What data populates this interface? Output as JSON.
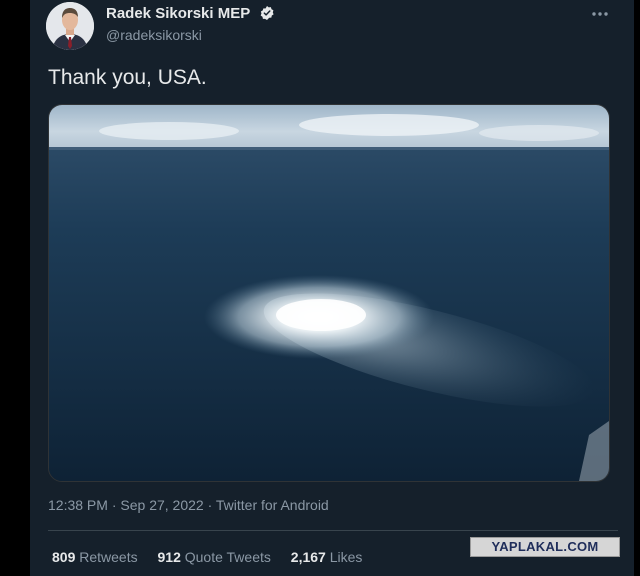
{
  "author": {
    "display_name": "Radek Sikorski MEP",
    "handle": "@radeksikorski",
    "verified": true,
    "avatar_icon": "person-portrait-avatar"
  },
  "tweet": {
    "text": "Thank you, USA.",
    "image_description": "aerial photo of sea surface with large circular patch of bubbling white water",
    "time": "12:38 PM",
    "date": "Sep 27, 2022",
    "source": "Twitter for Android",
    "separator": "·"
  },
  "stats": {
    "retweets_count": "809",
    "retweets_label": "Retweets",
    "quote_tweets_count": "912",
    "quote_tweets_label": "Quote Tweets",
    "likes_count": "2,167",
    "likes_label": "Likes"
  },
  "watermark": {
    "text": "YAPLAKAL.COM"
  },
  "colors": {
    "background": "#15202b",
    "primary_text": "#e7e9ea",
    "secondary_text": "#8b98a5",
    "verified_badge": "#e7e9ea",
    "divider": "#38444d"
  }
}
